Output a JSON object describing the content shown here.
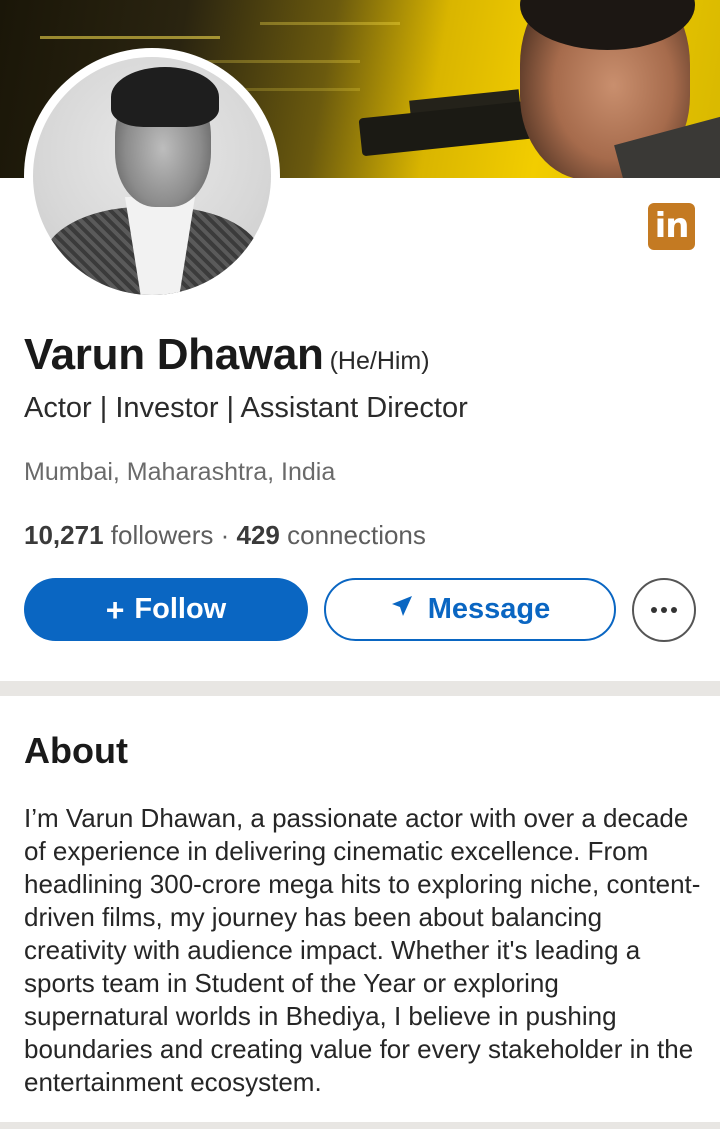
{
  "profile": {
    "name": "Varun Dhawan",
    "pronouns": "(He/Him)",
    "headline": "Actor | Investor | Assistant Director",
    "location": "Mumbai, Maharashtra, India",
    "followers_count": "10,271",
    "followers_label": "followers",
    "separator": "·",
    "connections_count": "429",
    "connections_label": "connections"
  },
  "badge": {
    "text": "in",
    "icon": "linkedin-icon"
  },
  "actions": {
    "follow_label": "Follow",
    "follow_icon": "plus-icon",
    "message_label": "Message",
    "message_icon": "send-icon",
    "more_icon": "more-icon"
  },
  "about": {
    "title": "About",
    "text": "I’m Varun Dhawan, a passionate actor with over a decade of experience in delivering cinematic excellence. From headlining 300-crore mega hits to exploring niche, content-driven films, my journey has been about balancing creativity with audience impact. Whether it's leading a sports team in Student of the Year or exploring supernatural worlds in Bhediya, I believe in pushing boundaries and creating value for every stakeholder in the entertainment ecosystem."
  },
  "colors": {
    "accent": "#0a66c2",
    "badge": "#c47a22",
    "divider": "#e8e6e3"
  }
}
